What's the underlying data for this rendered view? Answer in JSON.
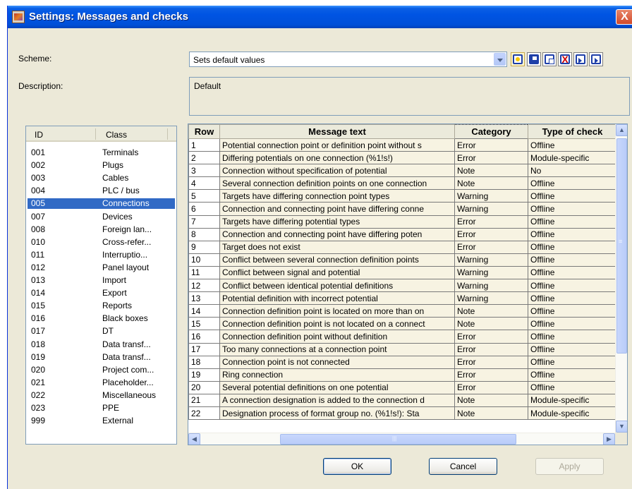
{
  "window": {
    "title": "Settings: Messages and checks",
    "close_glyph": "X"
  },
  "scheme": {
    "label": "Scheme:",
    "value": "Sets default values"
  },
  "toolbar": {
    "icons": [
      "new-icon",
      "save-icon",
      "copy-icon",
      "delete-icon",
      "import-icon",
      "export-icon"
    ],
    "delete_glyph": "X"
  },
  "description": {
    "label": "Description:",
    "value": "Default"
  },
  "class_list": {
    "headers": {
      "id": "ID",
      "class": "Class"
    },
    "selected_index": 4,
    "rows": [
      {
        "id": "001",
        "class": "Terminals"
      },
      {
        "id": "002",
        "class": "Plugs"
      },
      {
        "id": "003",
        "class": "Cables"
      },
      {
        "id": "004",
        "class": "PLC / bus"
      },
      {
        "id": "005",
        "class": "Connections"
      },
      {
        "id": "007",
        "class": "Devices"
      },
      {
        "id": "008",
        "class": "Foreign lan..."
      },
      {
        "id": "010",
        "class": "Cross-refer..."
      },
      {
        "id": "011",
        "class": "Interruptio..."
      },
      {
        "id": "012",
        "class": "Panel layout"
      },
      {
        "id": "013",
        "class": "Import"
      },
      {
        "id": "014",
        "class": "Export"
      },
      {
        "id": "015",
        "class": "Reports"
      },
      {
        "id": "016",
        "class": "Black boxes"
      },
      {
        "id": "017",
        "class": "DT"
      },
      {
        "id": "018",
        "class": "Data transf..."
      },
      {
        "id": "019",
        "class": "Data transf..."
      },
      {
        "id": "020",
        "class": "Project com..."
      },
      {
        "id": "021",
        "class": "Placeholder..."
      },
      {
        "id": "022",
        "class": "Miscellaneous"
      },
      {
        "id": "023",
        "class": "PPE"
      },
      {
        "id": "999",
        "class": "External"
      }
    ]
  },
  "messages_grid": {
    "headers": {
      "row": "Row",
      "text": "Message text",
      "category": "Category",
      "type": "Type of check"
    },
    "rows": [
      {
        "row": "1",
        "text": "Potential connection point or definition point without s",
        "category": "Error",
        "type": "Offline"
      },
      {
        "row": "2",
        "text": "Differing potentials on one connection (%1!s!)",
        "category": "Error",
        "type": "Module-specific"
      },
      {
        "row": "3",
        "text": "Connection without specification of potential",
        "category": "Note",
        "type": "No"
      },
      {
        "row": "4",
        "text": "Several connection definition points on one connection",
        "category": "Note",
        "type": "Offline"
      },
      {
        "row": "5",
        "text": "Targets have differing connection point types",
        "category": "Warning",
        "type": "Offline"
      },
      {
        "row": "6",
        "text": "Connection and connecting point have differing conne",
        "category": "Warning",
        "type": "Offline"
      },
      {
        "row": "7",
        "text": "Targets have differing potential types",
        "category": "Error",
        "type": "Offline"
      },
      {
        "row": "8",
        "text": "Connection and connecting point have differing poten",
        "category": "Error",
        "type": "Offline"
      },
      {
        "row": "9",
        "text": "Target does not exist",
        "category": "Error",
        "type": "Offline"
      },
      {
        "row": "10",
        "text": "Conflict between several connection definition points",
        "category": "Warning",
        "type": "Offline"
      },
      {
        "row": "11",
        "text": "Conflict between signal and potential",
        "category": "Warning",
        "type": "Offline"
      },
      {
        "row": "12",
        "text": "Conflict between identical potential definitions",
        "category": "Warning",
        "type": "Offline"
      },
      {
        "row": "13",
        "text": "Potential definition with incorrect potential",
        "category": "Warning",
        "type": "Offline"
      },
      {
        "row": "14",
        "text": "Connection definition point is located on more than on",
        "category": "Note",
        "type": "Offline"
      },
      {
        "row": "15",
        "text": "Connection definition point is not located on a connect",
        "category": "Note",
        "type": "Offline"
      },
      {
        "row": "16",
        "text": "Connection definition point without definition",
        "category": "Error",
        "type": "Offline"
      },
      {
        "row": "17",
        "text": "Too many connections at a connection point",
        "category": "Error",
        "type": "Offline"
      },
      {
        "row": "18",
        "text": "Connection point is not connected",
        "category": "Error",
        "type": "Offline"
      },
      {
        "row": "19",
        "text": "Ring connection",
        "category": "Error",
        "type": "Offline"
      },
      {
        "row": "20",
        "text": "Several potential definitions on one potential",
        "category": "Error",
        "type": "Offline"
      },
      {
        "row": "21",
        "text": "A connection designation is added to the connection d",
        "category": "Note",
        "type": "Module-specific"
      },
      {
        "row": "22",
        "text": "Designation process of format group no. (%1!s!): Sta",
        "category": "Note",
        "type": "Module-specific"
      }
    ],
    "scroll": {
      "up": "▲",
      "down": "▼",
      "left": "◀",
      "right": "▶",
      "grip": "≡",
      "hgrip": "|||"
    }
  },
  "buttons": {
    "ok": "OK",
    "cancel": "Cancel",
    "apply": "Apply"
  }
}
